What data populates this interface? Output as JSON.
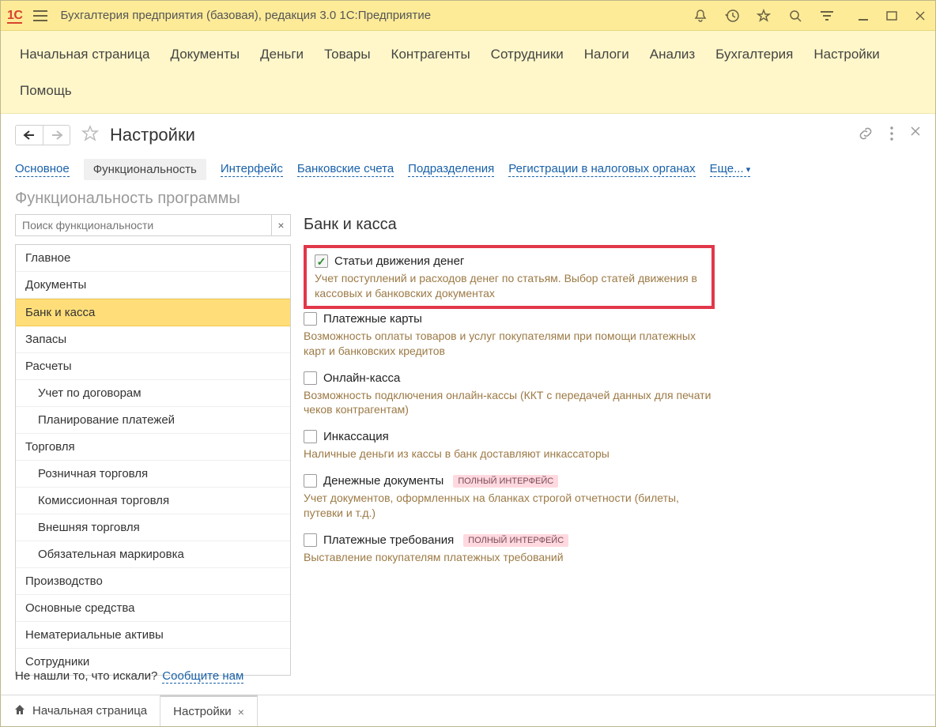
{
  "colors": {
    "accent": "#fdeb98",
    "highlight": "#e2374a",
    "link": "#1961a9",
    "desc": "#9c7a46"
  },
  "titlebar": {
    "app_title": "Бухгалтерия предприятия (базовая), редакция 3.0 1С:Предприятие"
  },
  "main_menu": [
    "Начальная страница",
    "Документы",
    "Деньги",
    "Товары",
    "Контрагенты",
    "Сотрудники",
    "Налоги",
    "Анализ",
    "Бухгалтерия",
    "Настройки",
    "Помощь"
  ],
  "page": {
    "title": "Настройки"
  },
  "subtabs": {
    "items": [
      "Основное",
      "Функциональность",
      "Интерфейс",
      "Банковские счета",
      "Подразделения",
      "Регистрации в налоговых органах"
    ],
    "active_index": 1,
    "more_label": "Еще..."
  },
  "section_subtitle": "Функциональность программы",
  "search": {
    "placeholder": "Поиск функциональности",
    "clear_glyph": "×"
  },
  "tree": [
    {
      "label": "Главное",
      "level": 0
    },
    {
      "label": "Документы",
      "level": 0
    },
    {
      "label": "Банк и касса",
      "level": 0,
      "selected": true
    },
    {
      "label": "Запасы",
      "level": 0
    },
    {
      "label": "Расчеты",
      "level": 0
    },
    {
      "label": "Учет по договорам",
      "level": 1
    },
    {
      "label": "Планирование платежей",
      "level": 1
    },
    {
      "label": "Торговля",
      "level": 0
    },
    {
      "label": "Розничная торговля",
      "level": 1
    },
    {
      "label": "Комиссионная торговля",
      "level": 1
    },
    {
      "label": "Внешняя торговля",
      "level": 1
    },
    {
      "label": "Обязательная маркировка",
      "level": 1
    },
    {
      "label": "Производство",
      "level": 0
    },
    {
      "label": "Основные средства",
      "level": 0
    },
    {
      "label": "Нематериальные активы",
      "level": 0
    },
    {
      "label": "Сотрудники",
      "level": 0
    }
  ],
  "panel": {
    "title": "Банк и касса",
    "options": [
      {
        "checked": true,
        "locked": true,
        "label": "Статьи движения денег",
        "desc": "Учет поступлений и расходов денег по статьям.\nВыбор статей движения в кассовых и банковских документах",
        "highlight": true
      },
      {
        "checked": false,
        "label": "Платежные карты",
        "desc": "Возможность оплаты товаров и услуг покупателями при помощи платежных карт и банковских кредитов"
      },
      {
        "checked": false,
        "label": "Онлайн-касса",
        "desc": "Возможность подключения онлайн-кассы (ККТ с передачей данных для печати чеков контрагентам)"
      },
      {
        "checked": false,
        "label": "Инкассация",
        "desc": "Наличные деньги из кассы в банк доставляют инкассаторы"
      },
      {
        "checked": false,
        "label": "Денежные документы",
        "badge": "ПОЛНЫЙ ИНТЕРФЕЙС",
        "desc": "Учет документов, оформленных на бланках строгой отчетности (билеты, путевки и т.д.)"
      },
      {
        "checked": false,
        "label": "Платежные требования",
        "badge": "ПОЛНЫЙ ИНТЕРФЕЙС",
        "desc": "Выставление покупателям платежных требований"
      }
    ]
  },
  "not_found": {
    "text": "Не нашли то, что искали?",
    "link": "Сообщите нам"
  },
  "bottom_tabs": [
    {
      "label": "Начальная страница",
      "icon": "home",
      "closable": false
    },
    {
      "label": "Настройки",
      "closable": true,
      "active": true
    }
  ]
}
